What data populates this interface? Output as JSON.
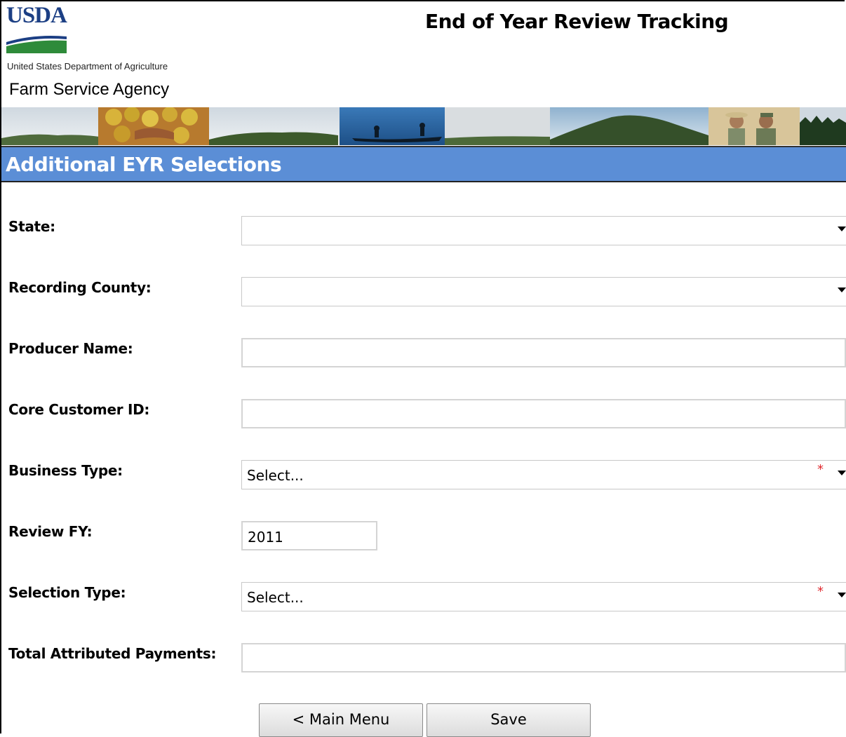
{
  "header": {
    "logo_text": "USDA",
    "department": "United States Department of Agriculture",
    "agency": "Farm Service Agency",
    "app_title": "End of Year Review Tracking"
  },
  "section": {
    "title": "Additional EYR Selections"
  },
  "form": {
    "state": {
      "label": "State:",
      "value": ""
    },
    "recording_county": {
      "label": "Recording County:",
      "value": ""
    },
    "producer_name": {
      "label": "Producer Name:",
      "value": ""
    },
    "core_customer_id": {
      "label": "Core Customer ID:",
      "value": ""
    },
    "business_type": {
      "label": "Business Type:",
      "value": "Select...",
      "required_mark": "*"
    },
    "review_fy": {
      "label": "Review FY:",
      "value": "2011"
    },
    "selection_type": {
      "label": "Selection Type:",
      "value": "Select...",
      "required_mark": "*"
    },
    "total_attributed_payments": {
      "label": "Total Attributed Payments:",
      "value": ""
    }
  },
  "buttons": {
    "main_menu": "< Main Menu",
    "save": "Save"
  },
  "colors": {
    "section_bg": "#5b8ed6",
    "usda_blue": "#1c3f84",
    "usda_green": "#2e8b3a",
    "required": "#e0282e"
  }
}
